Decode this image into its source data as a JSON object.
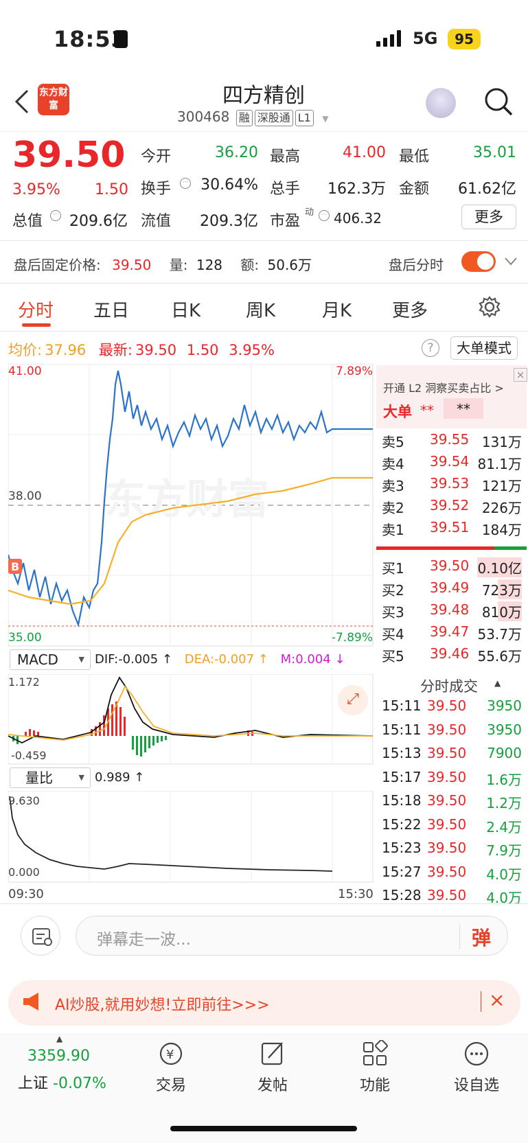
{
  "status": {
    "time": "18:53",
    "network": "5G",
    "battery": "95"
  },
  "header": {
    "title": "四方精创",
    "code": "300468",
    "tags": [
      "融",
      "深股通",
      "L1"
    ],
    "logo": "东方财富"
  },
  "quote": {
    "price": "39.50",
    "pct": "3.95%",
    "chg": "1.50",
    "rows": [
      [
        {
          "l": "今开",
          "v": "36.20",
          "c": "green"
        },
        {
          "l": "最高",
          "v": "41.00",
          "c": "red"
        },
        {
          "l": "最低",
          "v": "35.01",
          "c": "green"
        }
      ],
      [
        {
          "l": "换手",
          "v": "30.64%",
          "c": ""
        },
        {
          "l": "总手",
          "v": "162.3万",
          "c": ""
        },
        {
          "l": "金额",
          "v": "61.62亿",
          "c": ""
        }
      ],
      [
        {
          "l": "总值",
          "v": "209.6亿",
          "c": ""
        },
        {
          "l": "流值",
          "v": "209.3亿",
          "c": ""
        },
        {
          "l": "市盈",
          "v": "406.32",
          "c": ""
        }
      ]
    ],
    "pe_sup": "动",
    "more": "更多"
  },
  "after": {
    "label": "盘后固定价格:",
    "price": "39.50",
    "vol_label": "量:",
    "vol": "128",
    "amt_label": "额:",
    "amt": "50.6万",
    "toggle_label": "盘后分时"
  },
  "tabs": [
    "分时",
    "五日",
    "日K",
    "周K",
    "月K",
    "更多"
  ],
  "info": {
    "avg_label": "均价:",
    "avg": "37.96",
    "latest_label": "最新:",
    "latest": "39.50",
    "chg": "1.50",
    "pct": "3.95%",
    "mode": "大单模式"
  },
  "chart": {
    "top_price": "41.00",
    "top_pct": "7.89%",
    "mid_price": "38.00",
    "bot_price": "35.00",
    "bot_pct": "-7.89%",
    "watermark": "东方财富",
    "b_marker": "B",
    "x_start": "09:30",
    "x_end": "15:30"
  },
  "macd": {
    "name": "MACD",
    "dif": "DIF:-0.005 ↑",
    "dea": "DEA:-0.007 ↑",
    "m": "M:0.004 ↓",
    "top": "1.172",
    "bot": "-0.459"
  },
  "vr": {
    "name": "量比",
    "value": "0.989 ↑",
    "top": "9.630",
    "bot": "0.000"
  },
  "orderbook": {
    "promo": "开通 L2 洞察买卖占比 >",
    "big_label": "大单",
    "big_v1": "**",
    "big_v2": "**",
    "sells": [
      [
        "卖5",
        "39.55",
        "131万"
      ],
      [
        "卖4",
        "39.54",
        "81.1万"
      ],
      [
        "卖3",
        "39.53",
        "121万"
      ],
      [
        "卖2",
        "39.52",
        "226万"
      ],
      [
        "卖1",
        "39.51",
        "184万"
      ]
    ],
    "buys": [
      [
        "买1",
        "39.50",
        "0.10亿"
      ],
      [
        "买2",
        "39.49",
        "723万"
      ],
      [
        "买3",
        "39.48",
        "810万"
      ],
      [
        "买4",
        "39.47",
        "53.7万"
      ],
      [
        "买5",
        "39.46",
        "55.6万"
      ]
    ]
  },
  "trades": {
    "title": "分时成交",
    "rows": [
      [
        "15:11",
        "39.50",
        "3950"
      ],
      [
        "15:11",
        "39.50",
        "3950"
      ],
      [
        "15:13",
        "39.50",
        "7900"
      ],
      [
        "15:17",
        "39.50",
        "1.6万"
      ],
      [
        "15:18",
        "39.50",
        "1.2万"
      ],
      [
        "15:22",
        "39.50",
        "2.4万"
      ],
      [
        "15:23",
        "39.50",
        "7.9万"
      ],
      [
        "15:27",
        "39.50",
        "4.0万"
      ],
      [
        "15:28",
        "39.50",
        "4.0万"
      ]
    ]
  },
  "comment": {
    "placeholder": "弹幕走一波...",
    "btn": "弹"
  },
  "banner": {
    "text": "AI炒股,就用妙想!立即前往>>>"
  },
  "nav": {
    "index_value": "3359.90",
    "index_name": "上证",
    "index_pct": "-0.07%",
    "items": [
      "交易",
      "发帖",
      "功能",
      "设自选"
    ]
  }
}
